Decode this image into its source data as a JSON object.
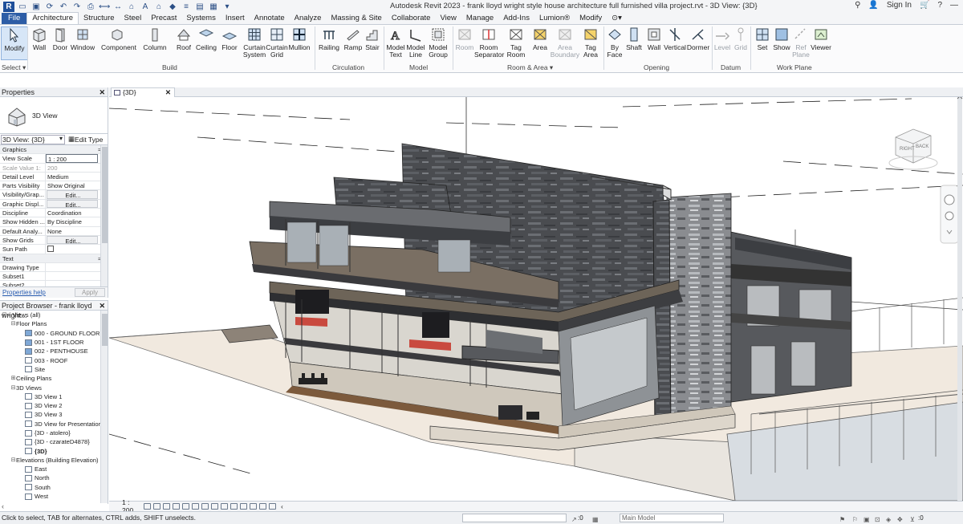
{
  "window": {
    "title": "Autodesk Revit 2023 - frank lloyd wright style house architecture full furnished villa project.rvt - 3D View: {3D}",
    "sign_in": "Sign In"
  },
  "ribbon": {
    "tabs": [
      "File",
      "Architecture",
      "Structure",
      "Steel",
      "Precast",
      "Systems",
      "Insert",
      "Annotate",
      "Analyze",
      "Massing & Site",
      "Collaborate",
      "View",
      "Manage",
      "Add-Ins",
      "Lumion®",
      "Modify"
    ],
    "active_tab": "Architecture",
    "buttons": {
      "modify": "Modify",
      "wall": "Wall",
      "door": "Door",
      "window": "Window",
      "component": "Component",
      "column": "Column",
      "roof": "Roof",
      "ceiling": "Ceiling",
      "floor": "Floor",
      "curtain_system_1": "Curtain",
      "curtain_system_2": "System",
      "curtain_grid_1": "Curtain",
      "curtain_grid_2": "Grid",
      "mullion": "Mullion",
      "railing": "Railing",
      "ramp": "Ramp",
      "stair": "Stair",
      "model_text_1": "Model",
      "model_text_2": "Text",
      "model_line_1": "Model",
      "model_line_2": "Line",
      "model_group_1": "Model",
      "model_group_2": "Group",
      "room": "Room",
      "room_sep_1": "Room",
      "room_sep_2": "Separator",
      "tag_room_1": "Tag",
      "tag_room_2": "Room",
      "area": "Area",
      "area_boundary_1": "Area",
      "area_boundary_2": "Boundary",
      "tag_area_1": "Tag",
      "tag_area_2": "Area",
      "by_face_1": "By",
      "by_face_2": "Face",
      "shaft": "Shaft",
      "wall_open": "Wall",
      "vertical": "Vertical",
      "dormer": "Dormer",
      "level": "Level",
      "grid": "Grid",
      "set": "Set",
      "show": "Show",
      "ref_plane_1": "Ref",
      "ref_plane_2": "Plane",
      "viewer": "Viewer"
    },
    "panels": {
      "select": "Select ▾",
      "build": "Build",
      "circulation": "Circulation",
      "model": "Model",
      "room_area": "Room & Area ▾",
      "opening": "Opening",
      "datum": "Datum",
      "work_plane": "Work Plane"
    }
  },
  "properties": {
    "header": "Properties",
    "type_name": "3D View",
    "instance_selector": "3D View: {3D}",
    "edit_type": "Edit Type",
    "rows": [
      {
        "k": "Graphics",
        "v": "",
        "kind": "group",
        "toggle": "≈"
      },
      {
        "k": "View Scale",
        "v": "1 : 200",
        "kind": "box"
      },
      {
        "k": "Scale Value    1:",
        "v": "200",
        "kind": "dim"
      },
      {
        "k": "Detail Level",
        "v": "Medium",
        "kind": "text"
      },
      {
        "k": "Parts Visibility",
        "v": "Show Original",
        "kind": "text"
      },
      {
        "k": "Visibility/Grap...",
        "v": "Edit...",
        "kind": "btn"
      },
      {
        "k": "Graphic Displ...",
        "v": "Edit...",
        "kind": "btn"
      },
      {
        "k": "Discipline",
        "v": "Coordination",
        "kind": "text"
      },
      {
        "k": "Show Hidden ...",
        "v": "By Discipline",
        "kind": "text"
      },
      {
        "k": "Default Analy...",
        "v": "None",
        "kind": "text"
      },
      {
        "k": "Show Grids",
        "v": "Edit...",
        "kind": "btn"
      },
      {
        "k": "Sun Path",
        "v": "",
        "kind": "check"
      },
      {
        "k": "Text",
        "v": "",
        "kind": "group",
        "toggle": "≈"
      },
      {
        "k": "Drawing Type",
        "v": "",
        "kind": "text"
      },
      {
        "k": "Subset1",
        "v": "",
        "kind": "text"
      },
      {
        "k": "Subset2",
        "v": "",
        "kind": "text"
      }
    ],
    "help_link": "Properties help",
    "apply": "Apply"
  },
  "browser": {
    "header": "Project Browser - frank lloyd wright...",
    "nodes": [
      {
        "label": "Views (all)",
        "level": 0,
        "toggle": "⊟",
        "icon": "root"
      },
      {
        "label": "Floor Plans",
        "level": 1,
        "toggle": "⊟",
        "icon": "none"
      },
      {
        "label": "000 - GROUND FLOOR",
        "level": 2,
        "toggle": "",
        "icon": "blue"
      },
      {
        "label": "001 - 1ST FLOOR",
        "level": 2,
        "toggle": "",
        "icon": "blue"
      },
      {
        "label": "002 - PENTHOUSE",
        "level": 2,
        "toggle": "",
        "icon": "blue"
      },
      {
        "label": "003 - ROOF",
        "level": 2,
        "toggle": "",
        "icon": "plain"
      },
      {
        "label": "Site",
        "level": 2,
        "toggle": "",
        "icon": "plain"
      },
      {
        "label": "Ceiling Plans",
        "level": 1,
        "toggle": "⊞",
        "icon": "none"
      },
      {
        "label": "3D Views",
        "level": 1,
        "toggle": "⊟",
        "icon": "none"
      },
      {
        "label": "3D View 1",
        "level": 2,
        "toggle": "",
        "icon": "plain"
      },
      {
        "label": "3D View 2",
        "level": 2,
        "toggle": "",
        "icon": "plain"
      },
      {
        "label": "3D View 3",
        "level": 2,
        "toggle": "",
        "icon": "plain"
      },
      {
        "label": "3D View for Presentation",
        "level": 2,
        "toggle": "",
        "icon": "plain"
      },
      {
        "label": "{3D - atolero}",
        "level": 2,
        "toggle": "",
        "icon": "plain"
      },
      {
        "label": "{3D - czarateD4878}",
        "level": 2,
        "toggle": "",
        "icon": "plain"
      },
      {
        "label": "{3D}",
        "level": 2,
        "toggle": "",
        "icon": "plain",
        "bold": true
      },
      {
        "label": "Elevations (Building Elevation)",
        "level": 1,
        "toggle": "⊟",
        "icon": "none"
      },
      {
        "label": "East",
        "level": 2,
        "toggle": "",
        "icon": "plain"
      },
      {
        "label": "North",
        "level": 2,
        "toggle": "",
        "icon": "plain"
      },
      {
        "label": "South",
        "level": 2,
        "toggle": "",
        "icon": "plain"
      },
      {
        "label": "West",
        "level": 2,
        "toggle": "",
        "icon": "plain"
      }
    ]
  },
  "view": {
    "tab_label": "{3D}",
    "viewcube_left": "RIGHT",
    "viewcube_right": "BACK",
    "scale": "1 : 200"
  },
  "status": {
    "message": "Click to select, TAB for alternates, CTRL adds, SHIFT unselects.",
    "zero1": ":0",
    "model": "Main Model",
    "zero2": ":0"
  }
}
